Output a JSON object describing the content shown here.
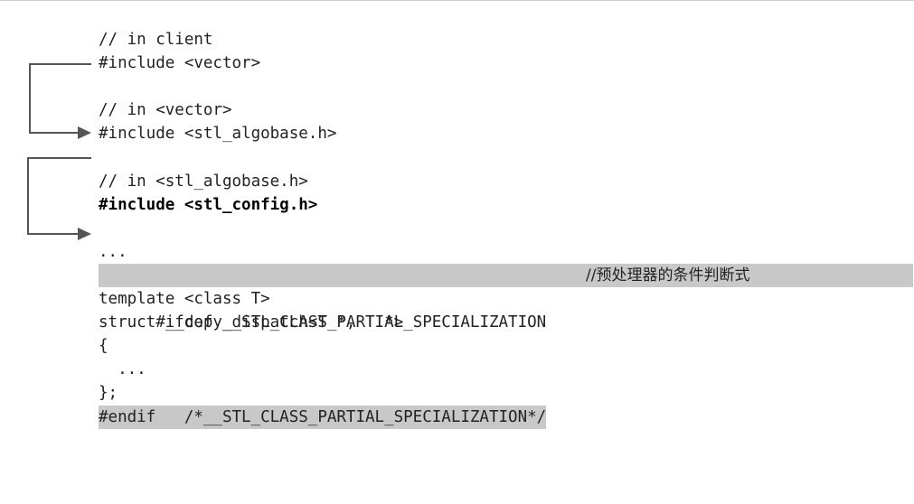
{
  "code": {
    "line1": "// in client",
    "line2": "#include <vector>",
    "line3": "// in <vector>",
    "line4": "#include <stl_algobase.h>",
    "line5": "// in <stl_algobase.h>",
    "line6": "#include <stl_config.h>",
    "line7": "...",
    "line8": "#ifdef __STL_CLASS_PARTIAL_SPECIALIZATION",
    "line8_comment": "//预处理器的条件判断式",
    "line9": "template <class T>",
    "line10": "struct __copy_dispatch<T *, T *>",
    "line11": "{",
    "line12": "  ...",
    "line13": "};",
    "line14": "#endif   /*__STL_CLASS_PARTIAL_SPECIALIZATION*/"
  },
  "colors": {
    "highlight": "#c8c8c8",
    "arrow": "#555555",
    "text": "#222222"
  },
  "icons": [
    "include-arrow-1",
    "include-arrow-2"
  ]
}
